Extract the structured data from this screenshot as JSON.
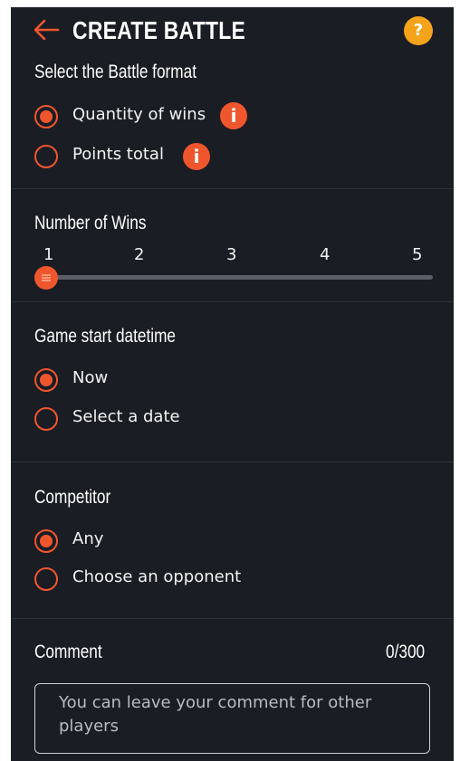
{
  "header": {
    "title": "CREATE BATTLE",
    "help_label": "?"
  },
  "battle_format": {
    "title": "Select the Battle format",
    "options": [
      {
        "label": "Quantity of wins",
        "selected": true,
        "info": "i"
      },
      {
        "label": "Points total",
        "selected": false,
        "info": "i"
      }
    ]
  },
  "wins": {
    "title": "Number of Wins",
    "ticks": [
      "1",
      "2",
      "3",
      "4",
      "5"
    ],
    "value": 1
  },
  "start": {
    "title": "Game start datetime",
    "options": [
      {
        "label": "Now",
        "selected": true
      },
      {
        "label": "Select a date",
        "selected": false
      }
    ]
  },
  "competitor": {
    "title": "Competitor",
    "options": [
      {
        "label": "Any",
        "selected": true
      },
      {
        "label": "Choose an opponent",
        "selected": false
      }
    ]
  },
  "comment": {
    "title": "Comment",
    "counter": "0/300",
    "placeholder": "You can leave your comment for other players"
  },
  "colors": {
    "accent": "#f0562e",
    "help": "#f5a31a",
    "background": "#1a1d24"
  }
}
